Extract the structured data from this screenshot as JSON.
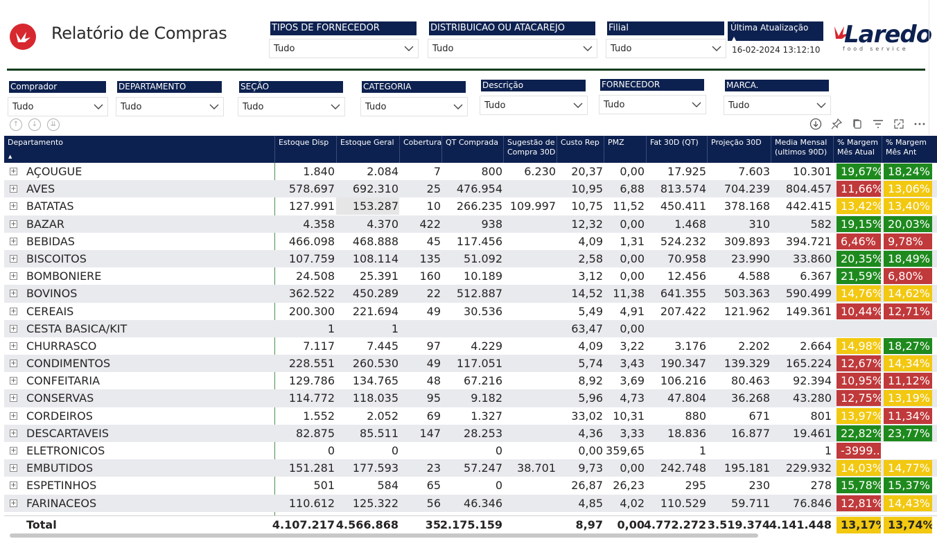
{
  "header": {
    "title": "Relatório de Compras",
    "last_update_label": "Última Atualização",
    "last_update_value": "16-02-2024 13:12:10",
    "brand_name": "Laredo",
    "brand_tagline": "food service"
  },
  "slicers_top": [
    {
      "label": "TIPOS DE FORNECEDOR",
      "value": "Tudo"
    },
    {
      "label": "DISTRIBUICAO OU ATACAREJO",
      "value": "Tudo"
    },
    {
      "label": "Filial",
      "value": "Tudo"
    }
  ],
  "slicers_second": [
    {
      "label": "Comprador",
      "value": "Tudo"
    },
    {
      "label": "DEPARTAMENTO",
      "value": "Tudo"
    },
    {
      "label": "SEÇÃO",
      "value": "Tudo"
    },
    {
      "label": "CATEGORIA",
      "value": "Tudo"
    },
    {
      "label": "Descrição",
      "value": "Tudo"
    },
    {
      "label": "FORNECEDOR",
      "value": "Tudo"
    },
    {
      "label": "MARCA.",
      "value": "Tudo"
    }
  ],
  "columns": [
    {
      "l1": "Departamento",
      "l2": ""
    },
    {
      "l1": "Estoque Disp",
      "l2": ""
    },
    {
      "l1": "Estoque Geral",
      "l2": ""
    },
    {
      "l1": "Cobertura",
      "l2": ""
    },
    {
      "l1": "QT Comprada",
      "l2": ""
    },
    {
      "l1": "Sugestão de",
      "l2": "Compra 30D"
    },
    {
      "l1": "Custo Rep",
      "l2": ""
    },
    {
      "l1": "PMZ",
      "l2": ""
    },
    {
      "l1": "Fat 30D (QT)",
      "l2": ""
    },
    {
      "l1": "Projeção 30D",
      "l2": ""
    },
    {
      "l1": "Media Mensal",
      "l2": "(ultimos 90D)"
    },
    {
      "l1": "% Margem",
      "l2": "Mês Atual"
    },
    {
      "l1": "% Margem",
      "l2": "Mês Ant"
    }
  ],
  "colors": {
    "header_bg": "#0d2150",
    "green": "#1e8a1e",
    "red": "#c0393b",
    "yellow": "#f2c811",
    "brand_red": "#d7282f"
  },
  "rows": [
    {
      "dept": "AÇOUGUE",
      "v": [
        "1.840",
        "2.084",
        "7",
        "800",
        "6.230",
        "20,37",
        "0,00",
        "17.925",
        "7.603",
        "10.301"
      ],
      "m1": "19,67%",
      "m1c": "green",
      "m2": "18,24%",
      "m2c": "green"
    },
    {
      "dept": "AVES",
      "v": [
        "578.697",
        "692.310",
        "25",
        "476.954",
        "",
        "10,95",
        "6,88",
        "813.574",
        "704.239",
        "804.457"
      ],
      "m1": "11,66%",
      "m1c": "red",
      "m2": "13,06%",
      "m2c": "yellow"
    },
    {
      "dept": "BATATAS",
      "v": [
        "127.991",
        "153.287",
        "10",
        "266.235",
        "109.997",
        "10,75",
        "11,52",
        "450.411",
        "378.168",
        "442.415"
      ],
      "m1": "13,42%",
      "m1c": "yellow",
      "m2": "13,40%",
      "m2c": "yellow"
    },
    {
      "dept": "BAZAR",
      "v": [
        "4.358",
        "4.370",
        "422",
        "938",
        "",
        "12,32",
        "0,00",
        "1.468",
        "310",
        "582"
      ],
      "m1": "19,15%",
      "m1c": "green",
      "m2": "20,03%",
      "m2c": "green"
    },
    {
      "dept": "BEBIDAS",
      "v": [
        "466.098",
        "468.888",
        "45",
        "117.456",
        "",
        "4,09",
        "1,31",
        "524.232",
        "309.893",
        "394.721"
      ],
      "m1": "6,46%",
      "m1c": "red",
      "m2": "9,78%",
      "m2c": "red"
    },
    {
      "dept": "BISCOITOS",
      "v": [
        "107.759",
        "108.114",
        "135",
        "51.092",
        "",
        "2,58",
        "0,00",
        "70.958",
        "23.990",
        "33.860"
      ],
      "m1": "20,35%",
      "m1c": "green",
      "m2": "18,49%",
      "m2c": "green"
    },
    {
      "dept": "BOMBONIERE",
      "v": [
        "24.508",
        "25.391",
        "160",
        "10.189",
        "",
        "3,12",
        "0,00",
        "12.456",
        "4.588",
        "6.367"
      ],
      "m1": "21,59%",
      "m1c": "green",
      "m2": "6,80%",
      "m2c": "red"
    },
    {
      "dept": "BOVINOS",
      "v": [
        "362.522",
        "450.289",
        "22",
        "512.887",
        "",
        "14,52",
        "11,38",
        "641.355",
        "503.363",
        "590.499"
      ],
      "m1": "14,76%",
      "m1c": "yellow",
      "m2": "14,62%",
      "m2c": "yellow"
    },
    {
      "dept": "CEREAIS",
      "v": [
        "200.300",
        "221.694",
        "49",
        "30.536",
        "",
        "5,49",
        "4,91",
        "207.422",
        "121.962",
        "149.361"
      ],
      "m1": "10,44%",
      "m1c": "red",
      "m2": "12,71%",
      "m2c": "red"
    },
    {
      "dept": "CESTA BASICA/KIT",
      "v": [
        "1",
        "1",
        "",
        "",
        "",
        "63,47",
        "0,00",
        "",
        "",
        ""
      ],
      "m1": "",
      "m1c": "none",
      "m2": "",
      "m2c": "none"
    },
    {
      "dept": "CHURRASCO",
      "v": [
        "7.117",
        "7.445",
        "97",
        "4.229",
        "",
        "4,09",
        "3,22",
        "3.176",
        "2.202",
        "2.664"
      ],
      "m1": "14,98%",
      "m1c": "yellow",
      "m2": "18,27%",
      "m2c": "green"
    },
    {
      "dept": "CONDIMENTOS",
      "v": [
        "228.551",
        "260.530",
        "49",
        "117.051",
        "",
        "5,74",
        "3,43",
        "190.347",
        "139.329",
        "165.224"
      ],
      "m1": "12,67%",
      "m1c": "red",
      "m2": "14,34%",
      "m2c": "yellow"
    },
    {
      "dept": "CONFEITARIA",
      "v": [
        "129.786",
        "134.765",
        "48",
        "67.216",
        "",
        "8,92",
        "3,69",
        "106.216",
        "80.463",
        "92.394"
      ],
      "m1": "10,95%",
      "m1c": "red",
      "m2": "11,12%",
      "m2c": "red"
    },
    {
      "dept": "CONSERVAS",
      "v": [
        "114.772",
        "118.035",
        "95",
        "9.182",
        "",
        "5,96",
        "4,73",
        "47.804",
        "36.268",
        "43.280"
      ],
      "m1": "12,75%",
      "m1c": "red",
      "m2": "13,19%",
      "m2c": "yellow"
    },
    {
      "dept": "CORDEIROS",
      "v": [
        "1.552",
        "2.052",
        "69",
        "1.327",
        "",
        "33,02",
        "10,31",
        "880",
        "671",
        "801"
      ],
      "m1": "13,97%",
      "m1c": "yellow",
      "m2": "11,34%",
      "m2c": "red"
    },
    {
      "dept": "DESCARTAVEIS",
      "v": [
        "82.875",
        "85.511",
        "147",
        "28.253",
        "",
        "4,36",
        "3,33",
        "18.836",
        "16.877",
        "19.461"
      ],
      "m1": "22,82%",
      "m1c": "green",
      "m2": "23,77%",
      "m2c": "green"
    },
    {
      "dept": "ELETRONICOS",
      "v": [
        "0",
        "0",
        "",
        "0",
        "",
        "0,00",
        "359,65",
        "1",
        "",
        "1"
      ],
      "m1": "-3999...",
      "m1c": "red",
      "m2": "",
      "m2c": "none"
    },
    {
      "dept": "EMBUTIDOS",
      "v": [
        "151.281",
        "177.593",
        "23",
        "57.247",
        "38.701",
        "9,73",
        "0,00",
        "242.748",
        "195.181",
        "229.932"
      ],
      "m1": "14,03%",
      "m1c": "yellow",
      "m2": "14,77%",
      "m2c": "yellow"
    },
    {
      "dept": "ESPETINHOS",
      "v": [
        "501",
        "584",
        "65",
        "0",
        "",
        "26,87",
        "26,23",
        "295",
        "230",
        "278"
      ],
      "m1": "15,78%",
      "m1c": "green",
      "m2": "15,37%",
      "m2c": "green"
    },
    {
      "dept": "FARINACEOS",
      "v": [
        "110.612",
        "125.322",
        "56",
        "46.346",
        "",
        "4,85",
        "4,02",
        "110.529",
        "59.711",
        "76.846"
      ],
      "m1": "12,81%",
      "m1c": "red",
      "m2": "14,43%",
      "m2c": "yellow"
    }
  ],
  "total": {
    "label": "Total",
    "v": [
      "4.107.217",
      "4.566.868",
      "35",
      "2.175.159",
      "",
      "8,97",
      "0,00",
      "4.772.272",
      "3.519.374",
      "4.141.448"
    ],
    "m1": "13,17%",
    "m1c": "yellow",
    "m2": "13,74%",
    "m2c": "yellow"
  }
}
